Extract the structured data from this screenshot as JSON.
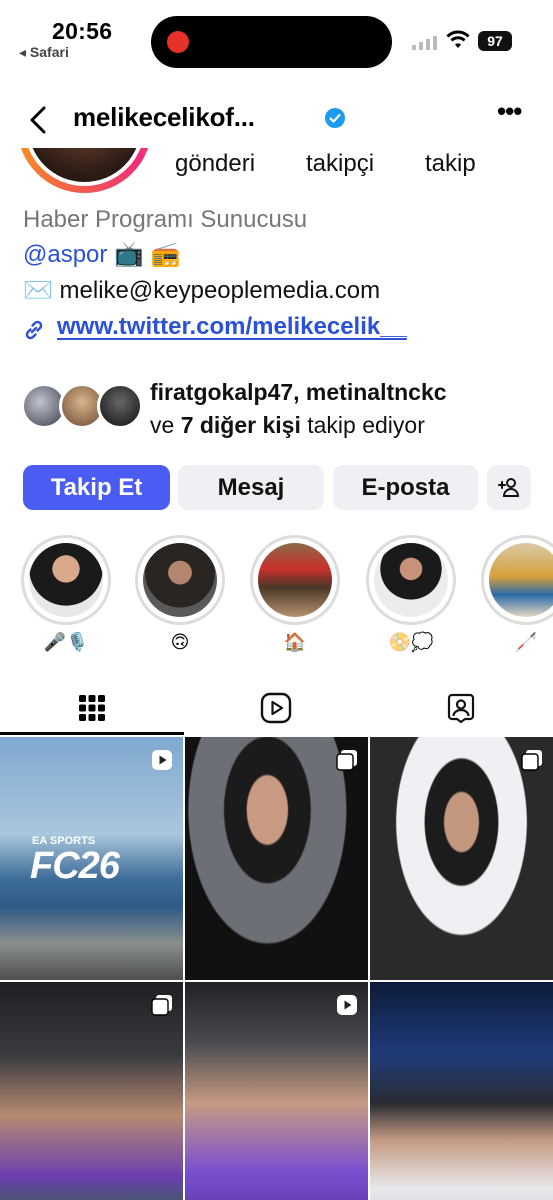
{
  "status": {
    "time": "20:56",
    "back_app": "◂ Safari",
    "battery": "97"
  },
  "header": {
    "username": "melikecelikof...",
    "more": "•••"
  },
  "stats": {
    "posts_label": "gönderi",
    "followers_label": "takipçi",
    "following_label": "takip"
  },
  "bio": {
    "category": "Haber Programı Sunucusu",
    "mention": "@aspor 📺 📻",
    "email": "✉️ melike@keypeoplemedia.com",
    "link": "www.twitter.com/melikecelik__"
  },
  "followed_by": {
    "names": "firatgokalp47, metinaltnckc",
    "prefix": "ve ",
    "others": "7 diğer kişi",
    "suffix": " takip ediyor"
  },
  "buttons": {
    "follow": "Takip Et",
    "message": "Mesaj",
    "email": "E-posta"
  },
  "highlights": [
    {
      "label": "🎤🎙️"
    },
    {
      "label": "🙃"
    },
    {
      "label": "🏠"
    },
    {
      "label": "📀💭"
    },
    {
      "label": "🦯"
    }
  ],
  "grid": {
    "post1_overlay": "FC26",
    "post1_brand": "EA SPORTS"
  },
  "colors": {
    "accent": "#4a5cf2",
    "link": "#2b51d8",
    "verified": "#1d9bf0"
  }
}
